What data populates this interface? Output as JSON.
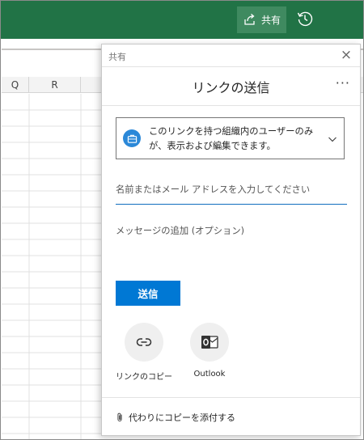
{
  "ribbon": {
    "share_label": "共有",
    "share_icon": "share-icon",
    "history_icon": "history-icon",
    "color": "#217346"
  },
  "grid": {
    "columns": [
      "Q",
      "R"
    ]
  },
  "panel": {
    "header_label": "共有",
    "title": "リンクの送信",
    "more_label": "···",
    "permission_text": "このリンクを持つ組織内のユーザーのみが、表示および編集できます。",
    "name_placeholder": "名前またはメール アドレスを入力してください",
    "message_placeholder": "メッセージの追加 (オプション)",
    "send_label": "送信",
    "options": [
      {
        "label": "リンクのコピー",
        "icon": "copy-link-icon"
      },
      {
        "label": "Outlook",
        "icon": "outlook-icon"
      }
    ],
    "attach_label": "代わりにコピーを添付する",
    "accent_color": "#0078d4"
  }
}
